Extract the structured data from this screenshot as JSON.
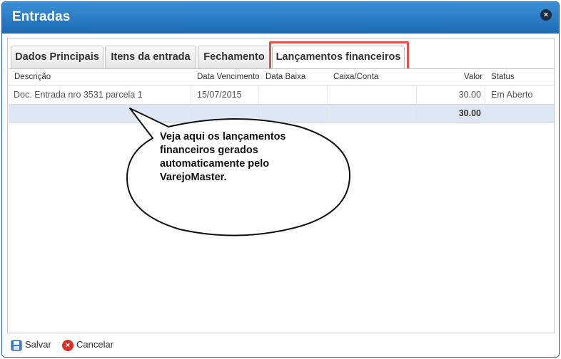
{
  "window": {
    "title": "Entradas",
    "close_label": "×"
  },
  "tabs": [
    {
      "label": "Dados Principais",
      "active": false
    },
    {
      "label": "Itens da entrada",
      "active": false
    },
    {
      "label": "Fechamento",
      "active": false
    },
    {
      "label": "Lançamentos financeiros",
      "active": true
    }
  ],
  "grid": {
    "columns": [
      "Descrição",
      "Data Vencimento",
      "Data Baixa",
      "Caixa/Conta",
      "Valor",
      "Status"
    ],
    "rows": [
      {
        "descricao": "Doc. Entrada nro 3531 parcela 1",
        "vencimento": "15/07/2015",
        "baixa": "",
        "caixa": "",
        "valor": "30.00",
        "status": "Em Aberto"
      }
    ],
    "total": {
      "valor": "30.00"
    }
  },
  "callout": {
    "text": "Veja aqui os lançamentos financeiros gerados automaticamente pelo VarejoMaster."
  },
  "footer": {
    "save_label": "Salvar",
    "cancel_label": "Cancelar"
  },
  "colors": {
    "titlebar": "#2a7cc7",
    "highlight": "#e0554a",
    "total_row": "#dde8f4",
    "cancel": "#d8322a"
  }
}
